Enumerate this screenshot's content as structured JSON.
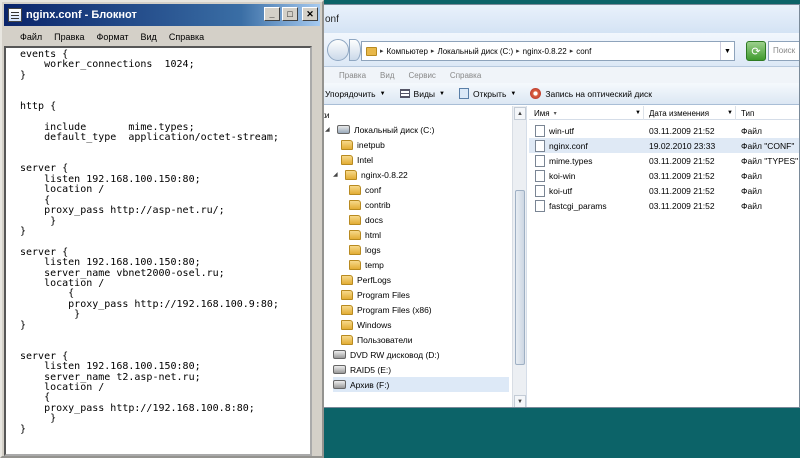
{
  "notepad": {
    "title": "nginx.conf - Блокнот",
    "menu": [
      "Файл",
      "Правка",
      "Формат",
      "Вид",
      "Справка"
    ],
    "text": "events {\n    worker_connections  1024;\n}\n\n\nhttp {\n\n    include       mime.types;\n    default_type  application/octet-stream;\n\n\nserver {\n    listen 192.168.100.150:80;\n    location /\n    {\n    proxy_pass http://asp-net.ru/;\n     }\n}\n\nserver {\n    listen 192.168.100.150:80;\n    server_name vbnet2000-osel.ru;\n    location /\n        {\n        proxy_pass http://192.168.100.9:80;\n         }\n}\n\n\nserver {\n    listen 192.168.100.150:80;\n    server_name t2.asp-net.ru;\n    location /\n    {\n    proxy_pass http://192.168.100.8:80;\n     }\n}"
  },
  "explorer": {
    "title": "onf",
    "breadcrumb": [
      "Компьютер",
      "Локальный диск (C:)",
      "nginx-0.8.22",
      "conf"
    ],
    "search_placeholder": "Поиск",
    "menu": [
      "Правка",
      "Вид",
      "Сервис",
      "Справка"
    ],
    "toolbar": {
      "organize": "Упорядочить",
      "views": "Виды",
      "open": "Открыть",
      "burn": "Запись на оптический диск"
    },
    "nav_header": "ки",
    "tree": [
      {
        "label": "Локальный диск (C:)",
        "type": "drive"
      },
      {
        "label": "inetpub",
        "type": "folder"
      },
      {
        "label": "Intel",
        "type": "folder"
      },
      {
        "label": "nginx-0.8.22",
        "type": "folder"
      },
      {
        "label": "conf",
        "type": "folder"
      },
      {
        "label": "contrib",
        "type": "folder"
      },
      {
        "label": "docs",
        "type": "folder"
      },
      {
        "label": "html",
        "type": "folder"
      },
      {
        "label": "logs",
        "type": "folder"
      },
      {
        "label": "temp",
        "type": "folder"
      },
      {
        "label": "PerfLogs",
        "type": "folder"
      },
      {
        "label": "Program Files",
        "type": "folder"
      },
      {
        "label": "Program Files (x86)",
        "type": "folder"
      },
      {
        "label": "Windows",
        "type": "folder"
      },
      {
        "label": "Пользователи",
        "type": "folder"
      },
      {
        "label": "DVD RW дисковод (D:)",
        "type": "drive"
      },
      {
        "label": "RAID5 (E:)",
        "type": "drive"
      },
      {
        "label": "Архив (F:)",
        "type": "drive"
      }
    ],
    "columns": {
      "name": "Имя",
      "modified": "Дата изменения",
      "type": "Тип"
    },
    "files": [
      {
        "name": "win-utf",
        "modified": "03.11.2009 21:52",
        "type": "Файл"
      },
      {
        "name": "nginx.conf",
        "modified": "19.02.2010 23:33",
        "type": "Файл \"CONF\""
      },
      {
        "name": "mime.types",
        "modified": "03.11.2009 21:52",
        "type": "Файл \"TYPES\""
      },
      {
        "name": "koi-win",
        "modified": "03.11.2009 21:52",
        "type": "Файл"
      },
      {
        "name": "koi-utf",
        "modified": "03.11.2009 21:52",
        "type": "Файл"
      },
      {
        "name": "fastcgi_params",
        "modified": "03.11.2009 21:52",
        "type": "Файл"
      }
    ]
  }
}
